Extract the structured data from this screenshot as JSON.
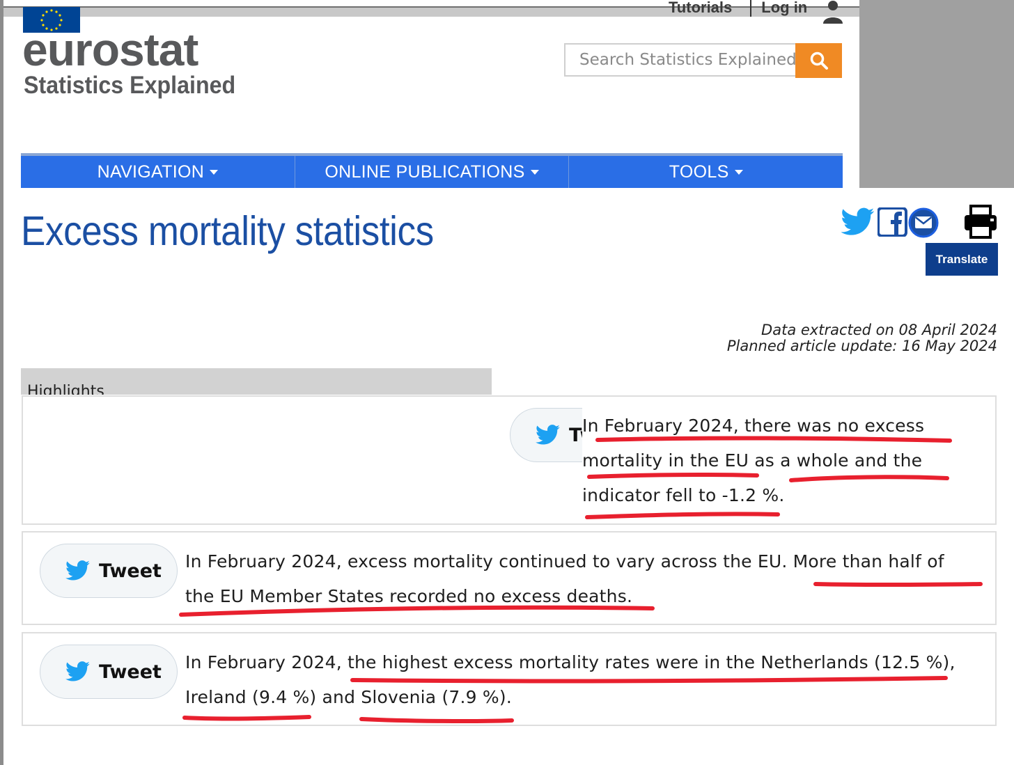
{
  "header": {
    "top_links": [
      "Tutorials",
      "Log in"
    ],
    "logo_word": "eurostat",
    "logo_subtitle": "Statistics Explained",
    "search": {
      "placeholder": "Search Statistics Explained"
    }
  },
  "nav": {
    "items": [
      {
        "label": "NAVIGATION"
      },
      {
        "label": "ONLINE PUBLICATIONS"
      },
      {
        "label": "TOOLS"
      }
    ]
  },
  "article": {
    "title": "Excess mortality statistics",
    "translate_label": "Translate",
    "data_extracted": "Data extracted on 08 April 2024",
    "planned_update": "Planned article update: 16 May 2024"
  },
  "highlights": {
    "tab_label": "Highlights",
    "tweet_label": "Tweet",
    "items": [
      {
        "line1": "In February 2024, there was no excess",
        "line2": "mortality in the EU as a whole and the",
        "line3": "indicator fell to -1.2 %."
      },
      {
        "line1": "In February 2024, excess mortality continued to vary across the EU. More than half of",
        "line2": "the EU Member States recorded no excess deaths."
      },
      {
        "line1": "In February 2024, the highest excess mortality rates were in the Netherlands (12.5 %),",
        "line2": "Ireland (9.4 %) and Slovenia (7.9 %)."
      }
    ]
  },
  "icons": [
    "eu-flag-icon",
    "user-icon",
    "search-icon",
    "twitter-icon",
    "facebook-icon",
    "email-icon",
    "print-icon"
  ],
  "colors": {
    "nav_blue": "#2a6ee6",
    "title_blue": "#1b4fa3",
    "search_orange": "#f08a24",
    "translate_blue": "#0e3e8c",
    "twitter_blue": "#1da1f2",
    "annotation_red": "#e8202e"
  }
}
